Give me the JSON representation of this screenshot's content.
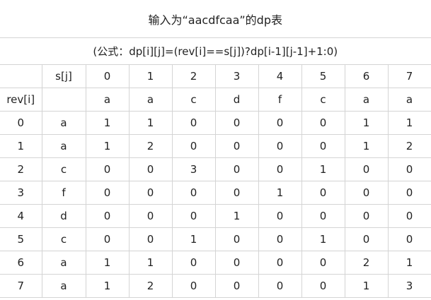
{
  "title": "输入为“aacdfcaa”的dp表",
  "formula": "(公式：dp[i][j]=(rev[i]==s[j])?dp[i-1][j-1]+1:0)",
  "corner_blank": "",
  "s_label": "s[j]",
  "rev_label": "rev[i]",
  "col_indices": [
    "0",
    "1",
    "2",
    "3",
    "4",
    "5",
    "6",
    "7"
  ],
  "s_chars": [
    "a",
    "a",
    "c",
    "d",
    "f",
    "c",
    "a",
    "a"
  ],
  "rows": [
    {
      "index": "0",
      "rev": "a",
      "values": [
        "1",
        "1",
        "0",
        "0",
        "0",
        "0",
        "1",
        "1"
      ]
    },
    {
      "index": "1",
      "rev": "a",
      "values": [
        "1",
        "2",
        "0",
        "0",
        "0",
        "0",
        "1",
        "2"
      ]
    },
    {
      "index": "2",
      "rev": "c",
      "values": [
        "0",
        "0",
        "3",
        "0",
        "0",
        "1",
        "0",
        "0"
      ]
    },
    {
      "index": "3",
      "rev": "f",
      "values": [
        "0",
        "0",
        "0",
        "0",
        "1",
        "0",
        "0",
        "0"
      ]
    },
    {
      "index": "4",
      "rev": "d",
      "values": [
        "0",
        "0",
        "0",
        "1",
        "0",
        "0",
        "0",
        "0"
      ]
    },
    {
      "index": "5",
      "rev": "c",
      "values": [
        "0",
        "0",
        "1",
        "0",
        "0",
        "1",
        "0",
        "0"
      ]
    },
    {
      "index": "6",
      "rev": "a",
      "values": [
        "1",
        "1",
        "0",
        "0",
        "0",
        "0",
        "2",
        "1"
      ]
    },
    {
      "index": "7",
      "rev": "a",
      "values": [
        "1",
        "2",
        "0",
        "0",
        "0",
        "0",
        "1",
        "3"
      ]
    }
  ]
}
